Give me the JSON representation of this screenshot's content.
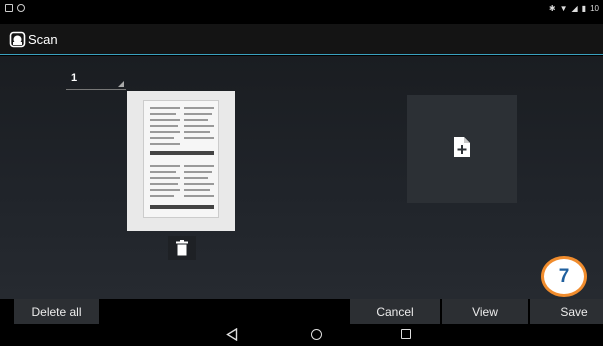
{
  "status_bar": {
    "right_text": "10"
  },
  "action_bar": {
    "title": "Scan",
    "icon": "scanner-app-icon"
  },
  "page_selector": {
    "value": "1"
  },
  "page_thumbnail": {
    "icon": "scanned-page-preview"
  },
  "icons": {
    "delete_page": "trash-icon",
    "add_page": "add-document-icon"
  },
  "buttons": {
    "delete_all": "Delete all",
    "cancel": "Cancel",
    "view": "View",
    "save": "Save"
  },
  "nav": {
    "back": "back-icon",
    "home": "home-icon",
    "recent": "recent-apps-icon"
  },
  "annotation": {
    "step": "7",
    "border_color": "#f08c2d",
    "text_color": "#1f5f9e"
  },
  "colors": {
    "accent": "#3aa1bf"
  }
}
